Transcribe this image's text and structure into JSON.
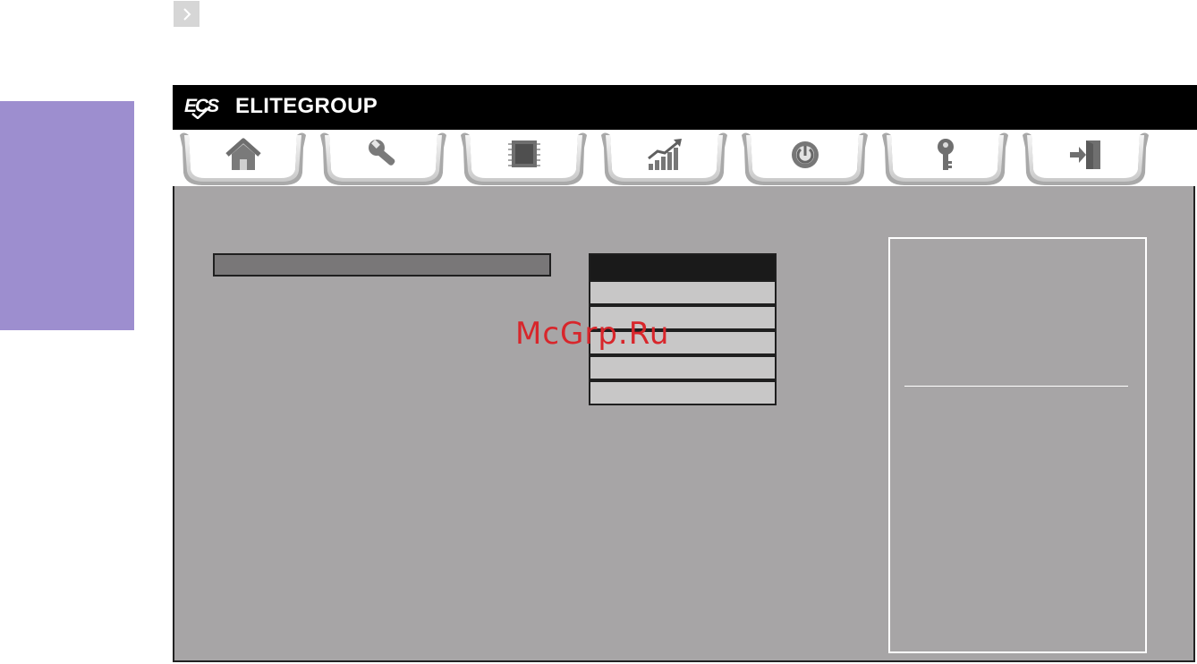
{
  "header": {
    "brand_name": "ELITEGROUP",
    "logo_mark": "ECS",
    "background": "#000000"
  },
  "side_tab": {
    "color": "#9d8ecf"
  },
  "expand_button": {
    "icon": "chevron-right-icon"
  },
  "tabs": [
    {
      "name": "main",
      "icon": "home-icon"
    },
    {
      "name": "advanced",
      "icon": "wrench-icon"
    },
    {
      "name": "chipset",
      "icon": "chip-icon"
    },
    {
      "name": "mi",
      "icon": "chart-up-icon"
    },
    {
      "name": "boot",
      "icon": "power-icon"
    },
    {
      "name": "security",
      "icon": "key-icon"
    },
    {
      "name": "exit",
      "icon": "exit-door-icon"
    }
  ],
  "main": {
    "background": "#a7a5a6",
    "input_bar": {
      "value": ""
    },
    "option_list": {
      "header": "",
      "items": [
        "",
        "",
        "",
        "",
        ""
      ]
    },
    "help_panel": {
      "text_top": "",
      "text_bottom": ""
    }
  },
  "watermark": {
    "text": "McGrp.Ru",
    "color": "#d8262b"
  }
}
